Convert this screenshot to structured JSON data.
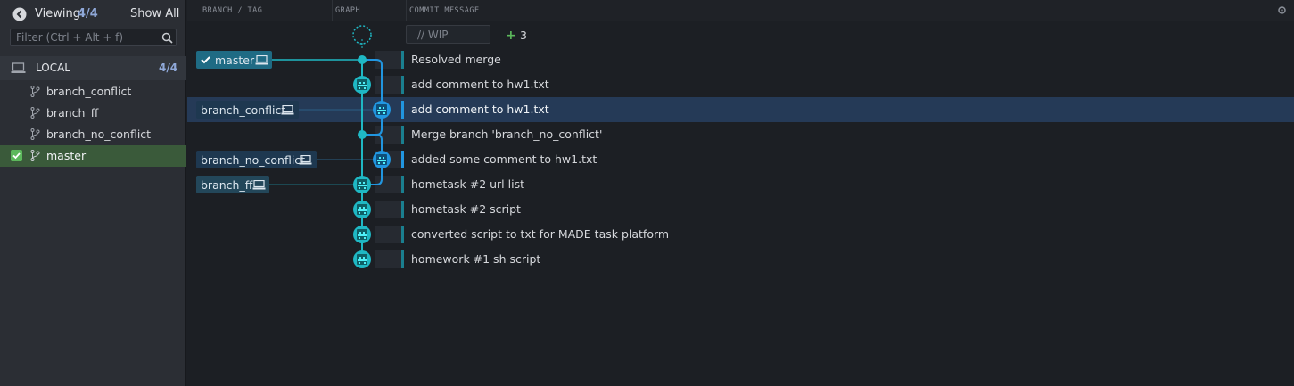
{
  "sidebar": {
    "viewing_label": "Viewing",
    "viewing_count": "4/4",
    "show_all": "Show All",
    "filter_placeholder": "Filter (Ctrl + Alt + f)",
    "local_label": "LOCAL",
    "local_count": "4/4",
    "branches": [
      {
        "name": "branch_conflict",
        "checked": false
      },
      {
        "name": "branch_ff",
        "checked": false
      },
      {
        "name": "branch_no_conflict",
        "checked": false
      },
      {
        "name": "master",
        "checked": true
      }
    ]
  },
  "columns": {
    "branch_tag": "BRANCH / TAG",
    "graph": "GRAPH",
    "commit_message": "COMMIT MESSAGE"
  },
  "wip": {
    "placeholder": "// WIP",
    "count": "3"
  },
  "refs": {
    "master": "master",
    "branch_conflict": "branch_conflict",
    "branch_no_conflict": "branch_no_conflict",
    "branch_ff": "branch_ff"
  },
  "commits": [
    "Resolved merge",
    "add comment to hw1.txt",
    "add comment to hw1.txt",
    "Merge branch 'branch_no_conflict'",
    "added some comment to hw1.txt",
    "hometask #2 url list",
    "hometask #2 script",
    "converted script to txt for MADE task platform",
    "homework #1 sh script"
  ],
  "colors": {
    "accent_teal": "#1fb8c4",
    "accent_blue": "#2196e0",
    "selected_row": "#253a57",
    "active_branch": "#3a5a3a"
  }
}
